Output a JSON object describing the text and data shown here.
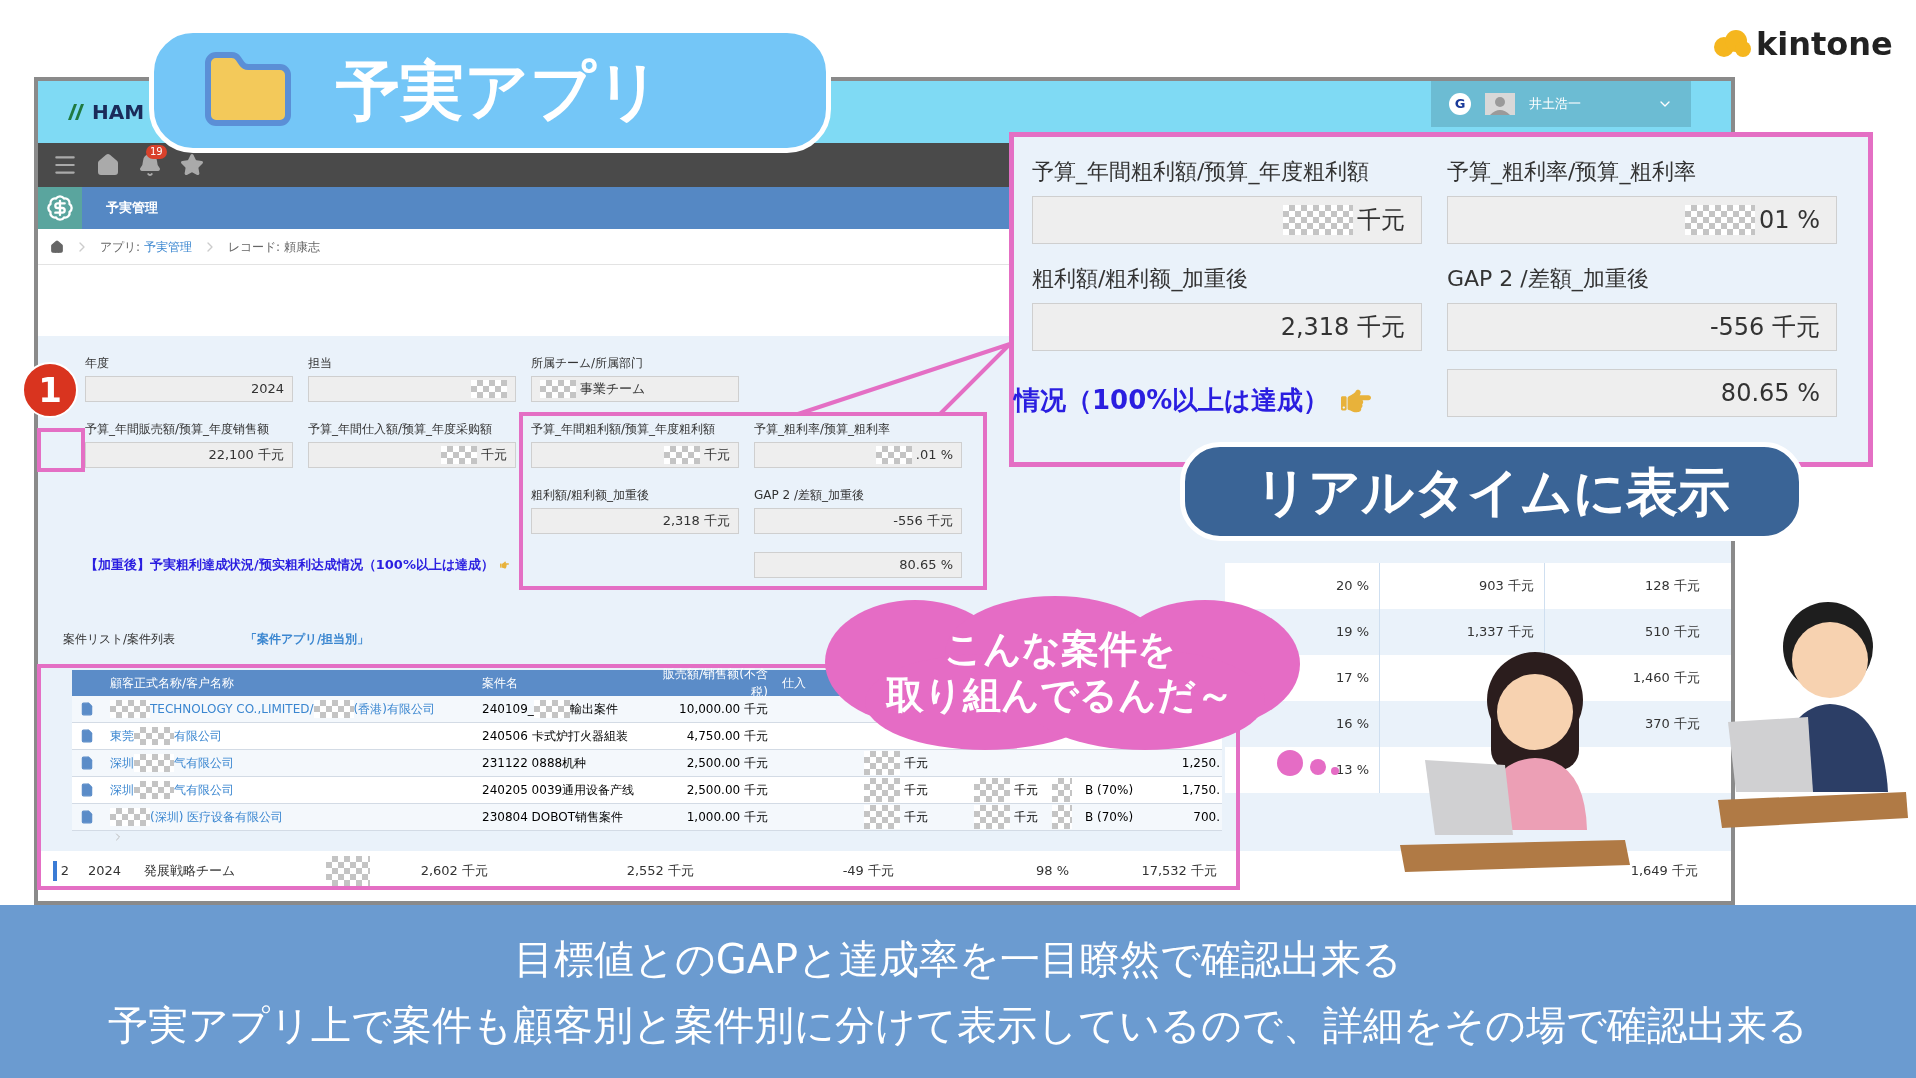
{
  "slide_title": "予実アプリ",
  "brand": "kintone",
  "step_number": "1",
  "screen": {
    "header": {
      "logo_text": "HAM",
      "user_initial": "G",
      "user_name": "井土浩一"
    },
    "nav": {
      "notification_count": "19"
    },
    "app_title": "予実管理",
    "breadcrumb": [
      {
        "kind": "link",
        "label": "アプリ:",
        "link": "予実管理"
      },
      {
        "kind": "text",
        "label": "レコード: 頼康志"
      }
    ],
    "form_rows": [
      [
        {
          "label": "年度",
          "masked": false,
          "value": "2024"
        },
        {
          "label": "担当",
          "masked": true
        },
        {
          "label": "所属チーム/所属部门",
          "masked": true,
          "value": "事業チーム"
        }
      ],
      [
        {
          "label": "予算_年間販売額/预算_年度销售额",
          "masked": false,
          "value": "22,100 千元"
        },
        {
          "label": "予算_年間仕入額/预算_年度采购額",
          "masked": true,
          "value": "千元"
        },
        {
          "label": "予算_年間粗利額/预算_年度粗利額",
          "masked": true,
          "value": "千元"
        },
        {
          "label": "予算_粗利率/预算_粗利率",
          "masked": true,
          "value": ".01 %"
        }
      ],
      [
        {
          "label": "粗利額/粗利额_加重後",
          "masked": false,
          "value": "2,318 千元"
        },
        {
          "label": "GAP 2 /差額_加重後",
          "masked": false,
          "value": "-556 千元"
        }
      ]
    ],
    "achievement": {
      "label": "【加重後】予実粗利達成状況/预实粗利达成情况（100%以上は達成）",
      "value": "80.65 %"
    },
    "list_title": "案件リスト/案件列表",
    "list_link": "「案件アプリ/担当別」",
    "list_columns": [
      "顧客正式名称/客户名称",
      "案件名",
      "販売額/销售额(不含税)",
      "仕入"
    ],
    "list_rows": [
      {
        "leading_mask": true,
        "customer": [
          "TECHNOLOGY CO.,LIMITED/",
          "(香港)有限公司"
        ],
        "project": [
          "240109_",
          "輸出案件"
        ],
        "sales": "10,000.00 千元"
      },
      {
        "leading_mask": false,
        "customer": [
          "東莞",
          "有限公司"
        ],
        "project": [
          "240506 卡式炉打火器組装"
        ],
        "sales": "4,750.00 千元"
      },
      {
        "leading_mask": false,
        "customer": [
          "深圳",
          "气有限公司"
        ],
        "project": [
          "231122 0888机种"
        ],
        "sales": "2,500.00 千元",
        "cost": "千元",
        "amount": "1,250."
      },
      {
        "leading_mask": false,
        "customer": [
          "深圳",
          "气有限公司"
        ],
        "project": [
          "240205 0039通用设备产线"
        ],
        "sales": "2,500.00 千元",
        "cost": "千元",
        "extra": "千元",
        "rank": "B (70%)",
        "amount": "1,750."
      },
      {
        "leading_mask": true,
        "customer": [
          "(深圳) 医疗设备有限公司"
        ],
        "project": [
          "230804 DOBOT销售案件"
        ],
        "sales": "1,000.00 千元",
        "cost": "千元",
        "extra": "千元",
        "rank": "B (70%)",
        "amount": "700."
      }
    ],
    "side_rows": [
      {
        "pct": "20 %",
        "a": "903 千元",
        "b": "128 千元"
      },
      {
        "pct": "19 %",
        "a": "1,337 千元",
        "b": "510 千元"
      },
      {
        "pct": "17 %",
        "b": "1,460 千元"
      },
      {
        "pct": "16 %",
        "b": "370 千元"
      },
      {
        "pct": "13 %"
      }
    ],
    "summary_row": {
      "number": "2",
      "year": "2024",
      "team": "発展戦略チーム",
      "cells": [
        "2,602 千元",
        "2,552 千元",
        "-49 千元",
        "98 %",
        "17,532 千元"
      ],
      "last": "1,649 千元"
    }
  },
  "zoom_panel": {
    "fields": [
      {
        "label": "予算_年間粗利額/预算_年度粗利額",
        "masked": true,
        "value": "千元"
      },
      {
        "label": "予算_粗利率/预算_粗利率",
        "masked": true,
        "value": "01 %"
      },
      {
        "label": "粗利額/粗利额_加重後",
        "masked": false,
        "value": "2,318 千元"
      },
      {
        "label": "GAP 2 /差額_加重後",
        "masked": false,
        "value": "-556 千元"
      }
    ],
    "achievement_label": "情况（100%以上は達成）",
    "achievement_value": "80.65 %"
  },
  "realtime_badge": "リアルタイムに表示",
  "thought_bubble": [
    "こんな案件を",
    "取り組んでるんだ～"
  ],
  "caption": [
    "目標値とのGAPと達成率を一目瞭然で確認出来る",
    "予実アプリ上で案件も顧客別と案件別に分けて表示しているので、詳細をその場で確認出来る"
  ]
}
